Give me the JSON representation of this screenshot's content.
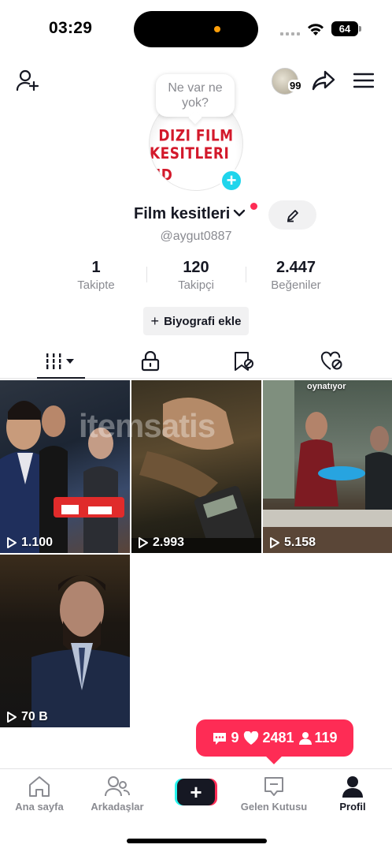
{
  "status_bar": {
    "time": "03:29",
    "battery": "64"
  },
  "header": {
    "visitor_count": "99"
  },
  "profile": {
    "bubble_text": "Ne var ne yok?",
    "avatar_line1": "DIZI FILM",
    "avatar_line2": "KESITLERI HD",
    "display_name": "Film kesitleri",
    "username": "@aygut0887"
  },
  "stats": [
    {
      "value": "1",
      "label": "Takipte"
    },
    {
      "value": "120",
      "label": "Takipçi"
    },
    {
      "value": "2.447",
      "label": "Beğeniler"
    }
  ],
  "bio_button": {
    "label": "Biyografi ekle"
  },
  "videos": [
    {
      "views": "1.100",
      "overlay": ""
    },
    {
      "views": "2.993",
      "overlay": ""
    },
    {
      "views": "5.158",
      "overlay": "oynatıyor"
    },
    {
      "views": "70 B",
      "overlay": ""
    }
  ],
  "watermark": "itemsatis",
  "notification": {
    "comments": "9",
    "likes": "2481",
    "followers": "119"
  },
  "bottom_nav": [
    {
      "label": "Ana sayfa"
    },
    {
      "label": "Arkadaşlar"
    },
    {
      "label": "Gelen Kutusu"
    },
    {
      "label": "Profil"
    }
  ],
  "colors": {
    "accent": "#fe2c55",
    "cyan": "#20d5ec",
    "text": "#161823",
    "muted": "#8a8b91"
  }
}
